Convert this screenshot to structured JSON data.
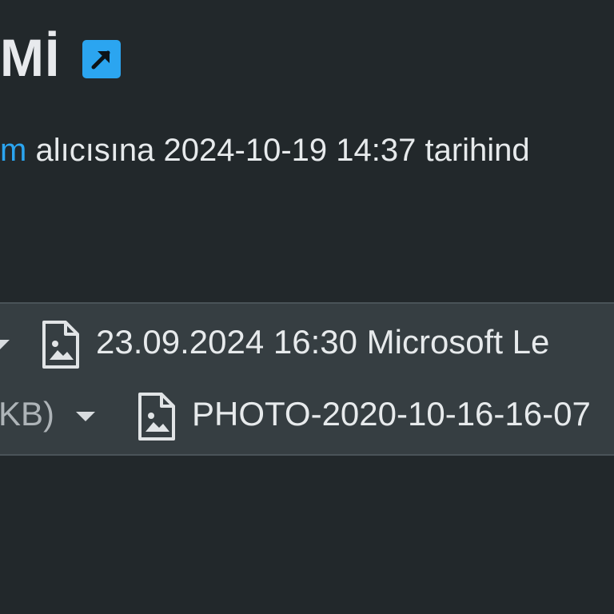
{
  "message": {
    "title": "Mİ",
    "external_link_icon": "external-link-arrow-icon",
    "recipient_link_text": "m",
    "recipient_sentence": " alıcısına 2024-10-19 14:37 tarihind"
  },
  "attachments": {
    "row1": {
      "file_name": "23.09.2024 16:30 Microsoft Le",
      "icon": "image-file-icon"
    },
    "row2": {
      "size_suffix": "KB)",
      "file_name": "PHOTO-2020-10-16-16-07",
      "icon": "image-file-icon"
    }
  },
  "colors": {
    "background": "#22282b",
    "attachment_bar": "#363e42",
    "accent": "#2ba5f0"
  }
}
